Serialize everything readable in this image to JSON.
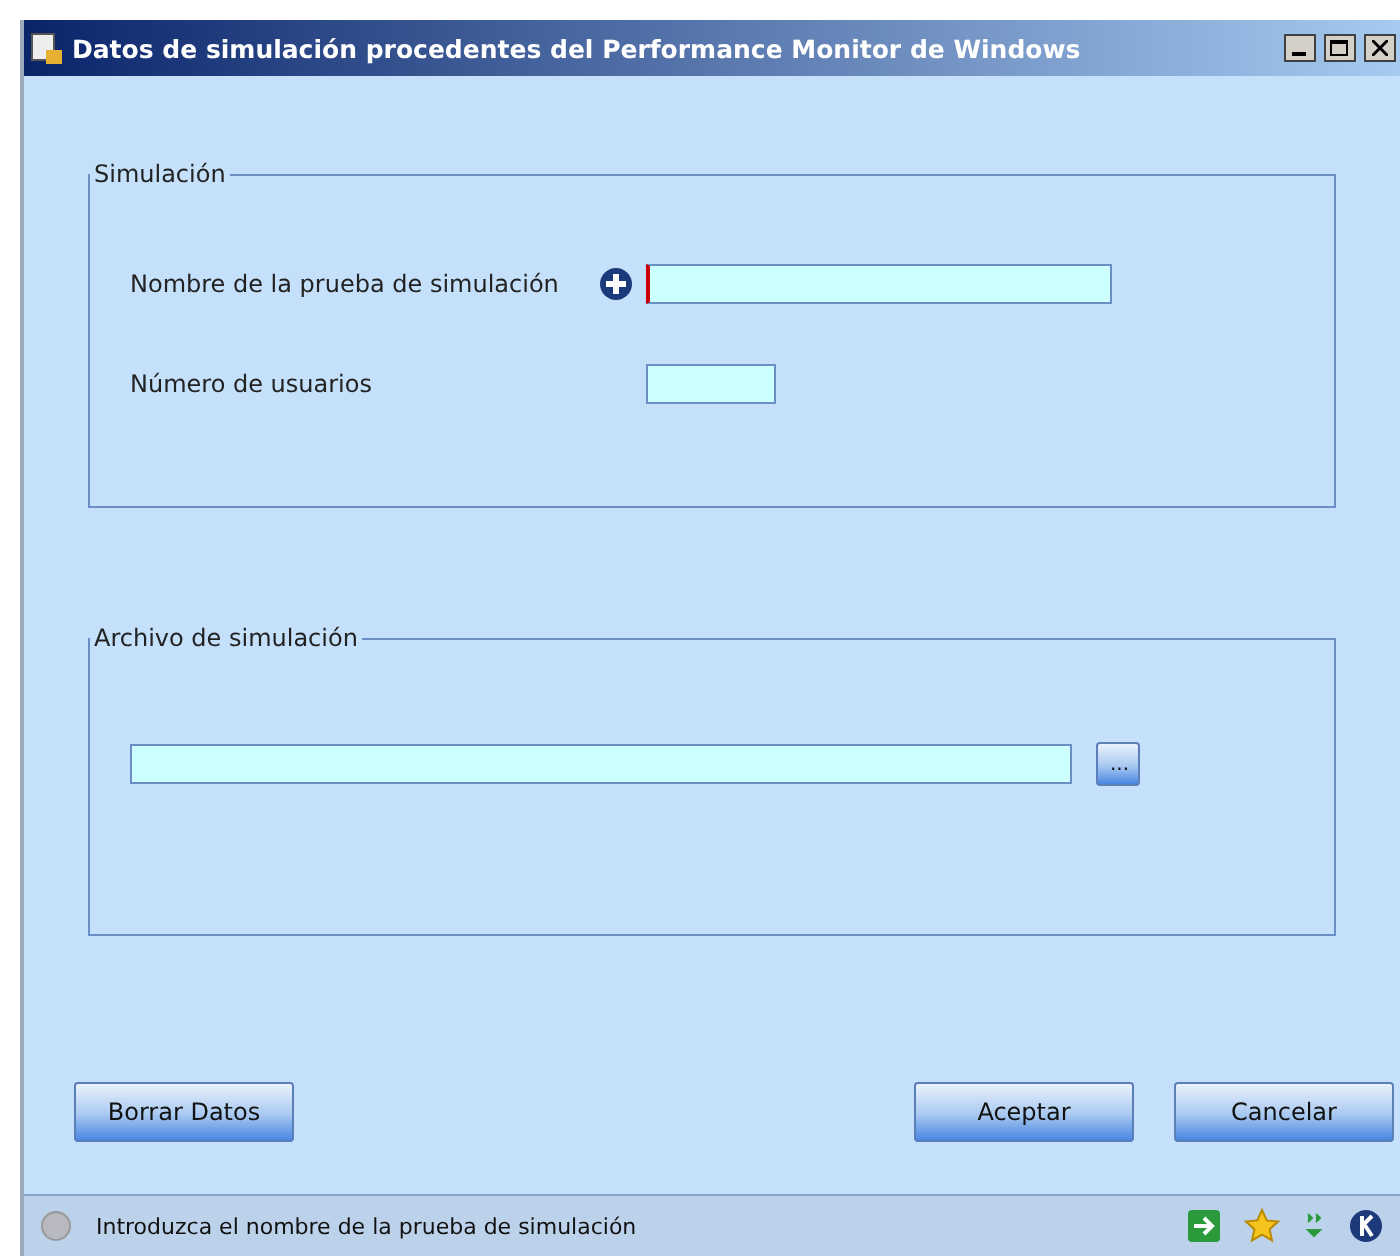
{
  "window": {
    "title": "Datos de simulación procedentes del Performance Monitor de Windows"
  },
  "simulation_group": {
    "legend": "Simulación",
    "fields": [
      {
        "label": "Nombre de la prueba de simulación",
        "required": true,
        "kind": "long"
      },
      {
        "label": "Número de usuarios",
        "required": false,
        "kind": "short"
      }
    ]
  },
  "file_group": {
    "legend": "Archivo de simulación",
    "browse_button": "..."
  },
  "buttons": {
    "clear": "Borrar Datos",
    "accept": "Aceptar",
    "cancel": "Cancelar"
  },
  "status_bar": {
    "message": "Introduzca el nombre de la prueba de simulación"
  }
}
